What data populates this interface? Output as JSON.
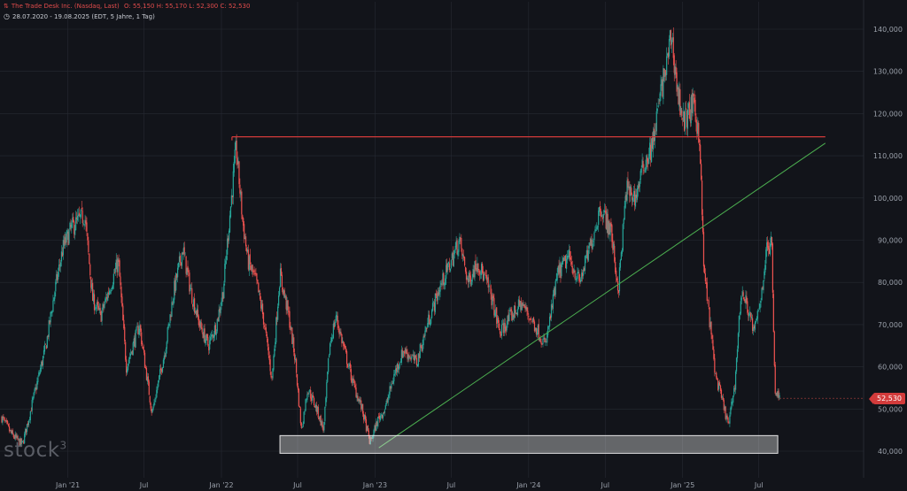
{
  "header": {
    "title_line": "The Trade Desk Inc. (Nasdaq, Last)",
    "ohlc": "O: 55,150   H: 55,170   L: 52,300   C: 52,530",
    "range_line": "28.07.2020 - 19.08.2025   (EDT, 5 Jahre, 1 Tag)"
  },
  "branding": {
    "logo": "stock",
    "logo_sup": "3"
  },
  "last_price_label": "52,530",
  "colors": {
    "up": "#26a69a",
    "down": "#ef5350",
    "resistance": "#d33a3a",
    "trendline": "#4caf50",
    "background": "#12141a",
    "grid": "#262a33"
  },
  "icons": {
    "header_symbol": "candlestick-logo-icon",
    "range_symbol": "clock-icon"
  },
  "chart_data": {
    "type": "candlestick",
    "title": "The Trade Desk Inc. (Nasdaq, Last)",
    "x_range": [
      "2020-07-28",
      "2025-08-19"
    ],
    "ylim": [
      36000,
      145000
    ],
    "y_axis_position": "right",
    "y_ticks": [
      40000,
      50000,
      60000,
      70000,
      80000,
      90000,
      100000,
      110000,
      120000,
      130000,
      140000
    ],
    "y_tick_labels": [
      "40,000",
      "50,000",
      "60,000",
      "70,000",
      "80,000",
      "90,000",
      "100,000",
      "110,000",
      "120,000",
      "130,000",
      "140,000"
    ],
    "x_ticks": [
      {
        "date": "2021-01-01",
        "label": "Jan '21"
      },
      {
        "date": "2021-07-01",
        "label": "Jul"
      },
      {
        "date": "2022-01-01",
        "label": "Jan '22"
      },
      {
        "date": "2022-07-01",
        "label": "Jul"
      },
      {
        "date": "2023-01-01",
        "label": "Jan '23"
      },
      {
        "date": "2023-07-01",
        "label": "Jul"
      },
      {
        "date": "2024-01-01",
        "label": "Jan '24"
      },
      {
        "date": "2024-07-01",
        "label": "Jul"
      },
      {
        "date": "2025-01-01",
        "label": "Jan '25"
      },
      {
        "date": "2025-07-01",
        "label": "Jul"
      }
    ],
    "grid": true,
    "close_path": [
      [
        "2020-07-28",
        48000
      ],
      [
        "2020-08-20",
        44000
      ],
      [
        "2020-09-15",
        41500
      ],
      [
        "2020-10-10",
        52000
      ],
      [
        "2020-11-10",
        65000
      ],
      [
        "2020-12-01",
        78000
      ],
      [
        "2020-12-20",
        88000
      ],
      [
        "2021-01-10",
        93000
      ],
      [
        "2021-02-10",
        96000
      ],
      [
        "2021-03-01",
        76000
      ],
      [
        "2021-03-20",
        72000
      ],
      [
        "2021-05-01",
        85000
      ],
      [
        "2021-05-20",
        60000
      ],
      [
        "2021-06-20",
        70000
      ],
      [
        "2021-07-20",
        49000
      ],
      [
        "2021-08-20",
        64000
      ],
      [
        "2021-09-10",
        78000
      ],
      [
        "2021-10-01",
        88000
      ],
      [
        "2021-10-20",
        78000
      ],
      [
        "2021-11-10",
        70000
      ],
      [
        "2021-12-01",
        65000
      ],
      [
        "2021-12-20",
        70000
      ],
      [
        "2022-01-05",
        78000
      ],
      [
        "2022-01-20",
        95000
      ],
      [
        "2022-02-05",
        112000
      ],
      [
        "2022-02-20",
        95000
      ],
      [
        "2022-03-05",
        85000
      ],
      [
        "2022-03-25",
        80000
      ],
      [
        "2022-04-10",
        72000
      ],
      [
        "2022-05-01",
        57000
      ],
      [
        "2022-05-20",
        82000
      ],
      [
        "2022-06-10",
        72000
      ],
      [
        "2022-06-25",
        62000
      ],
      [
        "2022-07-10",
        45000
      ],
      [
        "2022-07-25",
        55000
      ],
      [
        "2022-08-15",
        50000
      ],
      [
        "2022-09-01",
        45000
      ],
      [
        "2022-09-15",
        65000
      ],
      [
        "2022-09-30",
        72000
      ],
      [
        "2022-10-20",
        64000
      ],
      [
        "2022-11-10",
        56000
      ],
      [
        "2022-12-01",
        50000
      ],
      [
        "2022-12-20",
        42000
      ],
      [
        "2023-01-10",
        48000
      ],
      [
        "2023-01-25",
        50000
      ],
      [
        "2023-02-15",
        58000
      ],
      [
        "2023-03-10",
        64000
      ],
      [
        "2023-04-10",
        61000
      ],
      [
        "2023-05-05",
        70000
      ],
      [
        "2023-06-01",
        78000
      ],
      [
        "2023-07-01",
        85000
      ],
      [
        "2023-07-20",
        90000
      ],
      [
        "2023-08-10",
        80000
      ],
      [
        "2023-09-01",
        85000
      ],
      [
        "2023-10-01",
        78000
      ],
      [
        "2023-10-25",
        68000
      ],
      [
        "2023-11-20",
        72000
      ],
      [
        "2023-12-15",
        75000
      ],
      [
        "2024-01-15",
        70000
      ],
      [
        "2024-02-10",
        65000
      ],
      [
        "2024-03-10",
        82000
      ],
      [
        "2024-04-05",
        86000
      ],
      [
        "2024-05-01",
        80000
      ],
      [
        "2024-05-25",
        88000
      ],
      [
        "2024-06-20",
        98000
      ],
      [
        "2024-07-15",
        92000
      ],
      [
        "2024-08-01",
        78000
      ],
      [
        "2024-08-20",
        102000
      ],
      [
        "2024-09-10",
        100000
      ],
      [
        "2024-10-01",
        108000
      ],
      [
        "2024-10-20",
        112000
      ],
      [
        "2024-11-10",
        125000
      ],
      [
        "2024-11-25",
        132000
      ],
      [
        "2024-12-05",
        139000
      ],
      [
        "2024-12-20",
        125000
      ],
      [
        "2025-01-05",
        118000
      ],
      [
        "2025-01-25",
        122000
      ],
      [
        "2025-02-10",
        115000
      ],
      [
        "2025-02-20",
        84000
      ],
      [
        "2025-03-05",
        72000
      ],
      [
        "2025-03-20",
        58000
      ],
      [
        "2025-04-05",
        52000
      ],
      [
        "2025-04-20",
        46000
      ],
      [
        "2025-05-05",
        56000
      ],
      [
        "2025-05-20",
        78000
      ],
      [
        "2025-06-05",
        74000
      ],
      [
        "2025-06-20",
        68000
      ],
      [
        "2025-07-05",
        76000
      ],
      [
        "2025-07-20",
        88000
      ],
      [
        "2025-08-01",
        89000
      ],
      [
        "2025-08-08",
        55000
      ],
      [
        "2025-08-19",
        52530
      ]
    ],
    "last_price": 52530,
    "annotations": [
      {
        "type": "horizontal_line",
        "name": "resistance",
        "y": 114500,
        "from": "2022-01-26",
        "to": "2025-12-06"
      },
      {
        "type": "trendline",
        "name": "support-trend",
        "from": [
          "2023-01-10",
          40800
        ],
        "to": [
          "2025-12-06",
          113000
        ]
      },
      {
        "type": "rectangle",
        "name": "support-zone",
        "x_from": "2022-05-20",
        "x_to": "2025-08-15",
        "y_low": 39500,
        "y_high": 43700
      }
    ]
  }
}
